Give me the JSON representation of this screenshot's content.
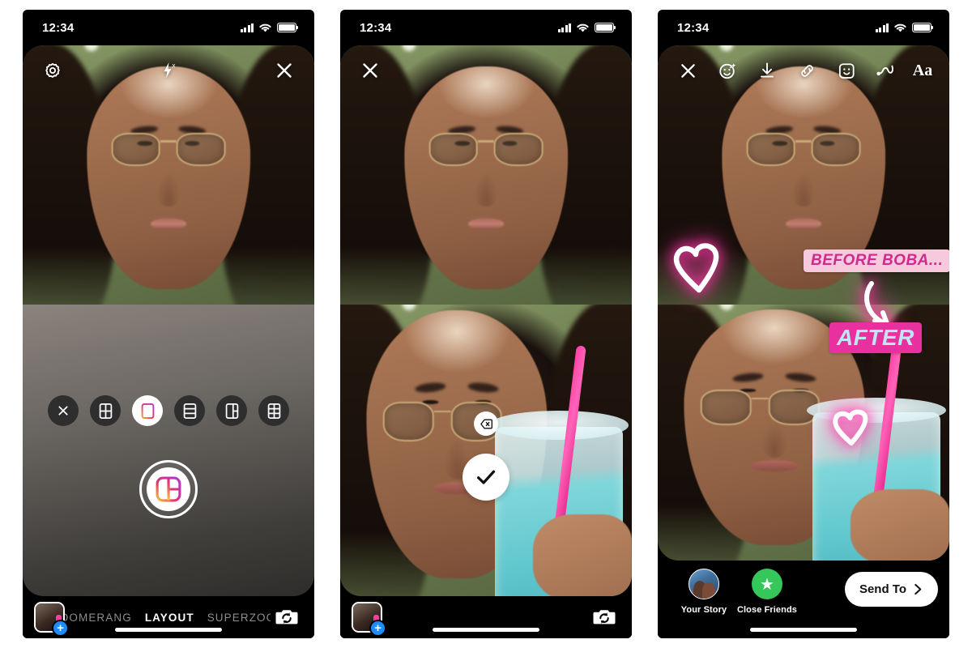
{
  "status_bar": {
    "time": "12:34",
    "signal_icon": "cellular-bars-icon",
    "wifi_icon": "wifi-icon",
    "battery_icon": "battery-icon"
  },
  "phone1": {
    "name": "instagram-layout-camera",
    "top_icons": [
      {
        "name": "settings-gear-icon",
        "label": "Settings"
      },
      {
        "name": "flash-off-icon",
        "label": "Flash Off"
      },
      {
        "name": "close-icon",
        "label": "Close"
      }
    ],
    "layout_options": [
      {
        "name": "layout-close-icon",
        "label": "Close layout picker",
        "glyph": "x",
        "selected": false
      },
      {
        "name": "layout-grid-2x2-icon",
        "label": "2 by 2 grid",
        "glyph": "grid2x2",
        "selected": false
      },
      {
        "name": "layout-split-2-icon",
        "label": "Two horizontal panes",
        "glyph": "split2",
        "selected": true
      },
      {
        "name": "layout-stack-3-icon",
        "label": "Three stacked panes",
        "glyph": "stack3",
        "selected": false
      },
      {
        "name": "layout-one-plus-two-icon",
        "label": "One plus two panes",
        "glyph": "onetwo",
        "selected": false
      },
      {
        "name": "layout-grid-3x2-icon",
        "label": "3 by 2 grid",
        "glyph": "grid3x2",
        "selected": false
      }
    ],
    "shutter": {
      "name": "layout-shutter-button",
      "label": "Capture"
    },
    "thumbnail": {
      "name": "gallery-thumbnail",
      "badge": "+"
    },
    "modes": [
      {
        "label": "OOMERANG",
        "active": false
      },
      {
        "label": "LAYOUT",
        "active": true
      },
      {
        "label": "SUPERZOO",
        "active": false
      }
    ],
    "flip_camera": {
      "name": "flip-camera-icon",
      "label": "Flip camera"
    }
  },
  "phone2": {
    "name": "instagram-layout-capture-review",
    "close": {
      "name": "close-icon",
      "label": "Close"
    },
    "delete_button": {
      "name": "delete-pane-button",
      "label": "Delete last photo"
    },
    "confirm_button": {
      "name": "confirm-check-button",
      "label": "Done"
    },
    "thumbnail": {
      "name": "gallery-thumbnail",
      "badge": "+"
    },
    "flip_camera": {
      "name": "flip-camera-icon",
      "label": "Flip camera"
    }
  },
  "phone3": {
    "name": "instagram-story-editor",
    "top_icons": [
      {
        "name": "close-icon",
        "label": "Close"
      },
      {
        "name": "effects-face-icon",
        "label": "Effects"
      },
      {
        "name": "download-icon",
        "label": "Save"
      },
      {
        "name": "link-icon",
        "label": "Link"
      },
      {
        "name": "sticker-icon",
        "label": "Stickers"
      },
      {
        "name": "draw-icon",
        "label": "Draw"
      },
      {
        "name": "text-aa-icon",
        "label": "Aa"
      }
    ],
    "stickers": [
      {
        "name": "text-sticker-before",
        "text": "BEFORE BOBA...",
        "bg": "#f6c9dd",
        "fg": "#d12a8e"
      },
      {
        "name": "text-sticker-after",
        "text": "AFTER",
        "bg": "#e8309e",
        "fg": "#bfe6f2"
      },
      {
        "name": "heart-doodle-large",
        "text": ""
      },
      {
        "name": "heart-doodle-small",
        "text": ""
      },
      {
        "name": "arrow-doodle",
        "text": ""
      }
    ],
    "share": {
      "your_story": {
        "name": "share-your-story",
        "label": "Your Story"
      },
      "close_friends": {
        "name": "share-close-friends",
        "label": "Close Friends",
        "color": "#35c759"
      },
      "send_to": {
        "name": "send-to-button",
        "label": "Send To"
      }
    }
  }
}
